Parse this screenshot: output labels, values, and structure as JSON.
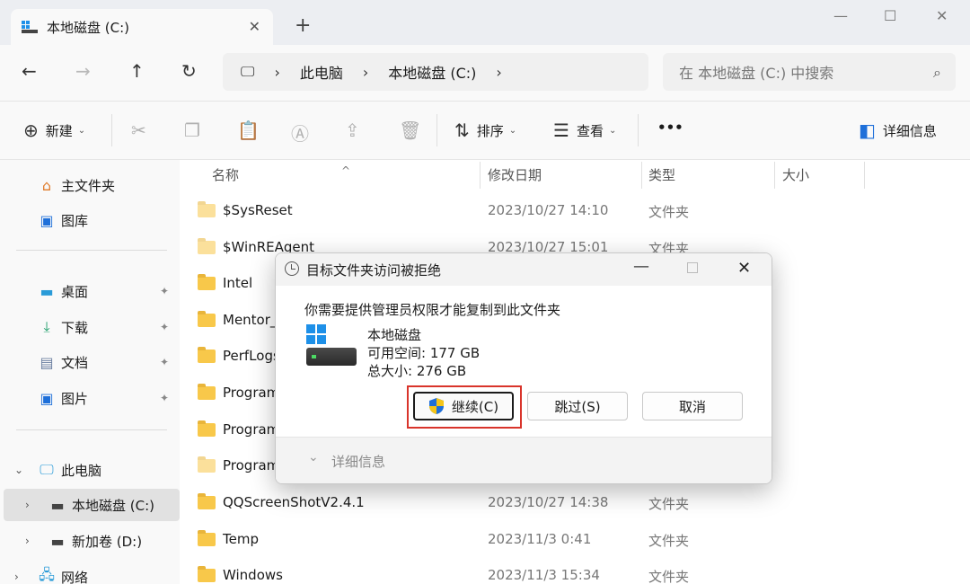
{
  "tab": {
    "title": "本地磁盘 (C:)",
    "close": "✕",
    "new_tab": "+"
  },
  "window": {
    "minimize": "—",
    "maximize": "☐",
    "close": "✕"
  },
  "nav": {
    "back": "←",
    "forward": "→",
    "up": "↑",
    "refresh": "↻",
    "path_sep": "›"
  },
  "address": {
    "pc_icon": "🖵",
    "crumbs": [
      "此电脑",
      "本地磁盘 (C:)"
    ]
  },
  "search": {
    "placeholder": "在 本地磁盘 (C:) 中搜索",
    "icon": "⌕"
  },
  "toolbar": {
    "new_label": "新建",
    "sort_label": "排序",
    "view_label": "查看",
    "more_label": "•••",
    "details_label": "详细信息",
    "caret": "⌄"
  },
  "sidebar": {
    "home": "主文件夹",
    "gallery": "图库",
    "desktop": "桌面",
    "downloads": "下载",
    "documents": "文档",
    "pictures": "图片",
    "this_pc": "此电脑",
    "drive_c": "本地磁盘 (C:)",
    "drive_d": "新加卷 (D:)",
    "network": "网络",
    "pin": "📌"
  },
  "columns": {
    "name": "名称",
    "modified": "修改日期",
    "type": "类型",
    "size": "大小",
    "sort_arrow": "^"
  },
  "files": [
    {
      "name": "$SysReset",
      "date": "2023/10/27 14:10",
      "type": "文件夹"
    },
    {
      "name": "$WinREAgent",
      "date": "2023/10/27 15:01",
      "type": "文件夹"
    },
    {
      "name": "Intel",
      "date": "",
      "type": ""
    },
    {
      "name": "Mentor_",
      "date": "",
      "type": ""
    },
    {
      "name": "PerfLogs",
      "date": "",
      "type": ""
    },
    {
      "name": "Program",
      "date": "",
      "type": ""
    },
    {
      "name": "Program",
      "date": "",
      "type": ""
    },
    {
      "name": "Program",
      "date": "",
      "type": ""
    },
    {
      "name": "QQScreenShotV2.4.1",
      "date": "2023/10/27 14:38",
      "type": "文件夹"
    },
    {
      "name": "Temp",
      "date": "2023/11/3 0:41",
      "type": "文件夹"
    },
    {
      "name": "Windows",
      "date": "2023/11/3 15:34",
      "type": "文件夹"
    }
  ],
  "dialog": {
    "title": "目标文件夹访问被拒绝",
    "message": "你需要提供管理员权限才能复制到此文件夹",
    "drive_name": "本地磁盘",
    "free_space": "可用空间: 177 GB",
    "total_size": "总大小: 276 GB",
    "continue_label": "继续(C)",
    "skip_label": "跳过(S)",
    "cancel_label": "取消",
    "details_label": "详细信息",
    "minimize": "—",
    "close": "✕",
    "chevron": "⌄",
    "highlight_color": "#d9342b"
  }
}
